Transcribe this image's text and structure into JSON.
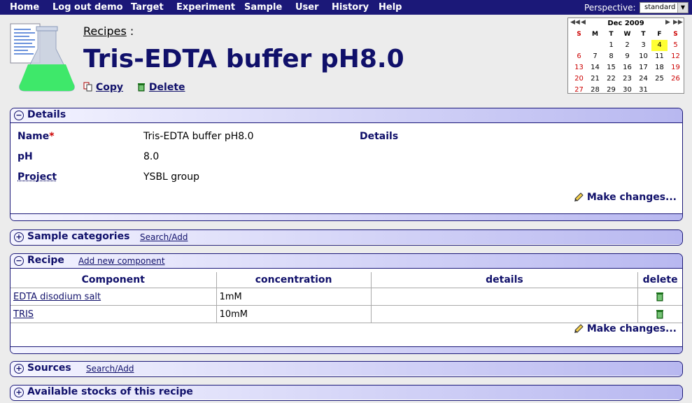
{
  "nav": {
    "items": [
      "Home",
      "Log out demo",
      "Target",
      "Experiment",
      "Sample",
      "User",
      "History",
      "Help"
    ],
    "perspective_label": "Perspective:",
    "perspective_value": "standard"
  },
  "header": {
    "breadcrumb": "Recipes",
    "breadcrumb_sep": ":",
    "title": "Tris-EDTA buffer pH8.0",
    "copy_label": "Copy",
    "delete_label": "Delete"
  },
  "calendar": {
    "month": "Dec 2009",
    "days_of_week": [
      "S",
      "M",
      "T",
      "W",
      "T",
      "F",
      "S"
    ],
    "weeks": [
      [
        "",
        "",
        "1",
        "2",
        "3",
        "4",
        "5"
      ],
      [
        "6",
        "7",
        "8",
        "9",
        "10",
        "11",
        "12"
      ],
      [
        "13",
        "14",
        "15",
        "16",
        "17",
        "18",
        "19"
      ],
      [
        "20",
        "21",
        "22",
        "23",
        "24",
        "25",
        "26"
      ],
      [
        "27",
        "28",
        "29",
        "30",
        "31",
        "",
        ""
      ]
    ],
    "today": "4"
  },
  "details": {
    "title": "Details",
    "name_label": "Name",
    "name_required": "*",
    "name_value": "Tris-EDTA buffer pH8.0",
    "details_label": "Details",
    "ph_label": "pH",
    "ph_value": "8.0",
    "project_label": "Project",
    "project_value": "YSBL group",
    "make_changes": "Make changes..."
  },
  "sample_categories": {
    "title": "Sample categories",
    "link": "Search/Add"
  },
  "recipe": {
    "title": "Recipe",
    "link": "Add new component",
    "columns": [
      "Component",
      "concentration",
      "details",
      "delete"
    ],
    "rows": [
      {
        "component": "EDTA disodium salt",
        "concentration": "1mM",
        "details": ""
      },
      {
        "component": "TRIS",
        "concentration": "10mM",
        "details": ""
      }
    ],
    "make_changes": "Make changes..."
  },
  "sources": {
    "title": "Sources",
    "link": "Search/Add"
  },
  "stocks": {
    "title": "Available stocks of this recipe"
  }
}
